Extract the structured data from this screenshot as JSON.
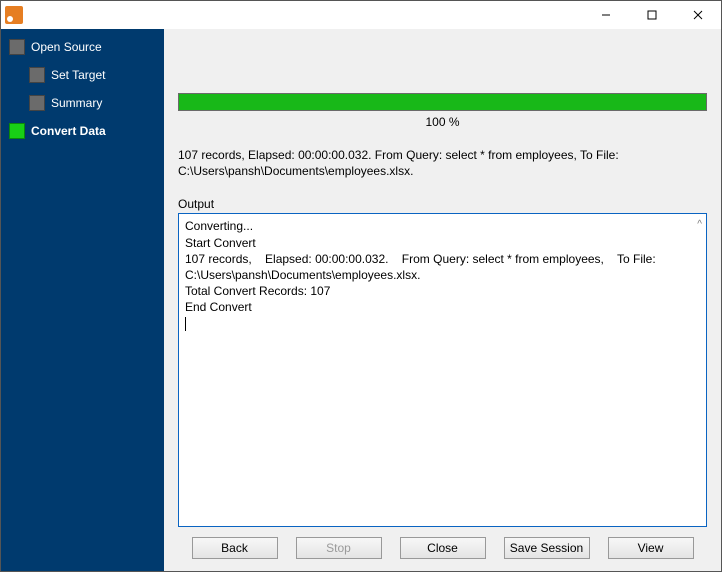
{
  "sidebar": {
    "items": [
      {
        "label": "Open Source",
        "active": false
      },
      {
        "label": "Set Target",
        "active": false
      },
      {
        "label": "Summary",
        "active": false
      },
      {
        "label": "Convert Data",
        "active": true
      }
    ]
  },
  "progress": {
    "percent_label": "100 %"
  },
  "status_line": "107 records,    Elapsed: 00:00:00.032.    From Query: select * from employees,    To File: C:\\Users\\pansh\\Documents\\employees.xlsx.",
  "output": {
    "label": "Output",
    "text": "Converting...\nStart Convert\n107 records,    Elapsed: 00:00:00.032.    From Query: select * from employees,    To File: C:\\Users\\pansh\\Documents\\employees.xlsx.\nTotal Convert Records: 107\nEnd Convert"
  },
  "buttons": {
    "back": "Back",
    "stop": "Stop",
    "close": "Close",
    "save_session": "Save Session",
    "view": "View"
  }
}
